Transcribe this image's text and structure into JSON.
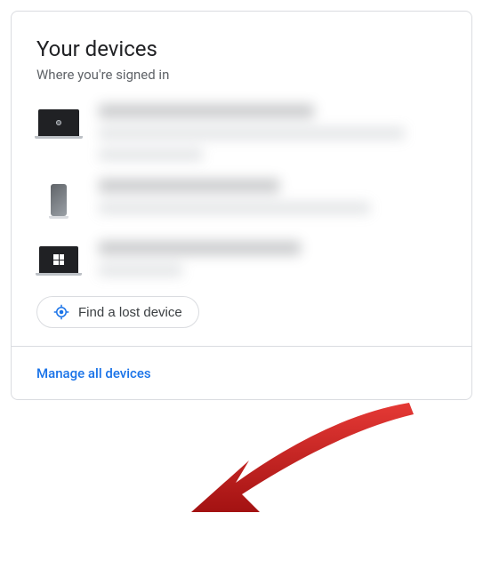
{
  "card": {
    "title": "Your devices",
    "subtitle": "Where you're signed in"
  },
  "devices": [
    {
      "icon": "laptop-chrome"
    },
    {
      "icon": "phone"
    },
    {
      "icon": "laptop-windows"
    }
  ],
  "findLost": {
    "label": "Find a lost device"
  },
  "footer": {
    "manage": "Manage all devices"
  },
  "colors": {
    "accent": "#1a73e8",
    "text": "#202124",
    "muted": "#5f6368",
    "border": "#dadce0",
    "arrow": "#c91f1f"
  },
  "annotation": {
    "arrow_points_to": "manage-all-devices-link"
  }
}
